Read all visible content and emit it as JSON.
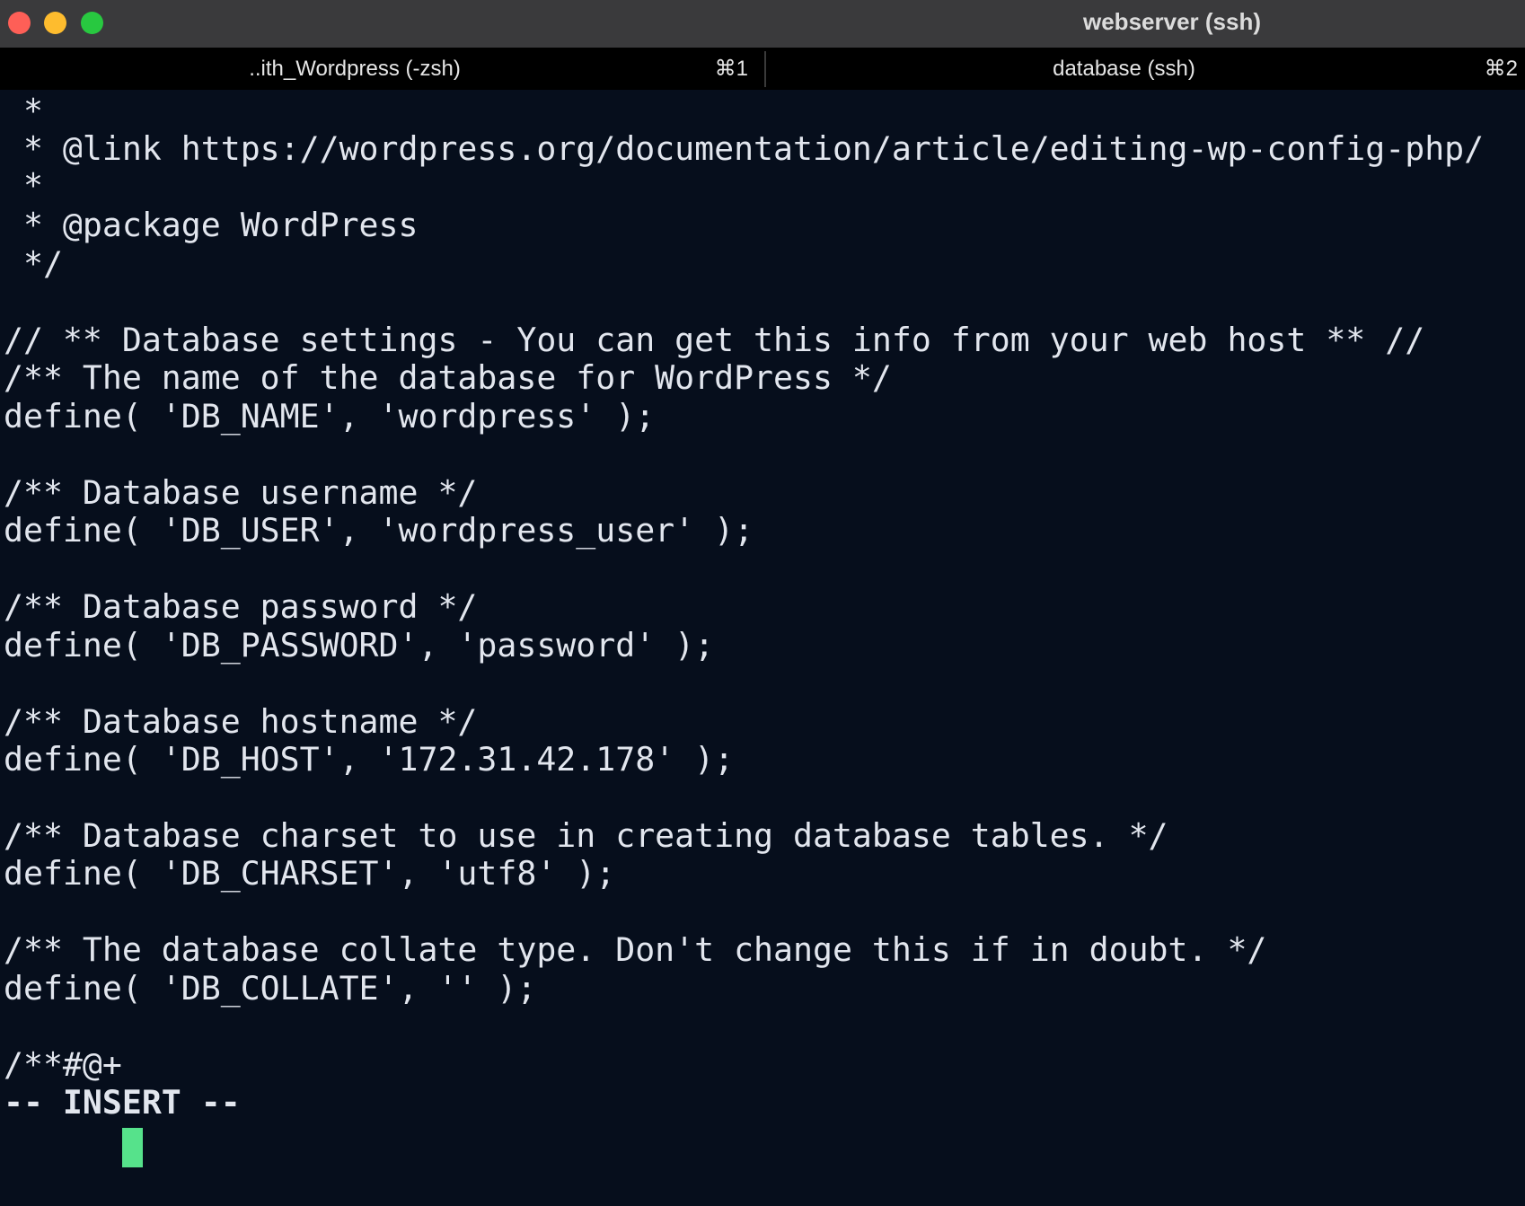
{
  "window": {
    "title": "webserver (ssh)"
  },
  "tabs": [
    {
      "label": "..ith_Wordpress (-zsh)",
      "shortcut": "⌘1"
    },
    {
      "label": "database (ssh)",
      "shortcut": "⌘2"
    }
  ],
  "editor": {
    "lines": [
      " *",
      " * @link https://wordpress.org/documentation/article/editing-wp-config-php/",
      " *",
      " * @package WordPress",
      " */",
      "",
      "// ** Database settings - You can get this info from your web host ** //",
      "/** The name of the database for WordPress */",
      "define( 'DB_NAME', 'wordpress' );",
      "",
      "/** Database username */",
      "define( 'DB_USER', 'wordpress_user' );",
      "",
      "/** Database password */",
      "define( 'DB_PASSWORD', 'password' );",
      "",
      "/** Database hostname */",
      "define( 'DB_HOST', '172.31.42.178' );",
      "",
      "/** Database charset to use in creating database tables. */",
      "define( 'DB_CHARSET', 'utf8' );",
      "",
      "/** The database collate type. Don't change this if in doubt. */",
      "define( 'DB_COLLATE', '' );",
      "",
      "/**#@+"
    ],
    "mode": "-- INSERT --",
    "cursor_color": "#56e28b",
    "background_color": "#060e1c",
    "text_color": "#e2e6ee"
  }
}
